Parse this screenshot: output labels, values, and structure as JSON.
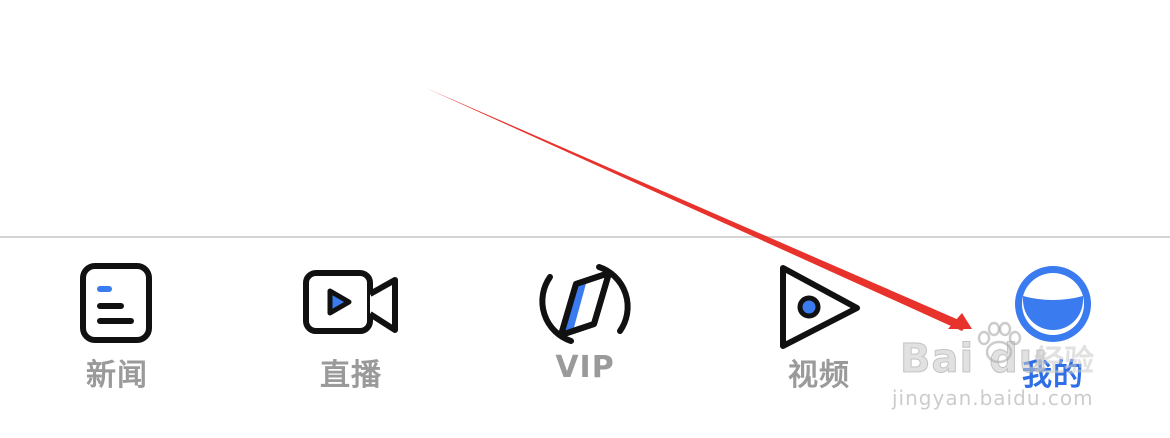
{
  "tab_bar": {
    "items": [
      {
        "label": "新闻",
        "icon": "news-document-icon",
        "active": false
      },
      {
        "label": "直播",
        "icon": "video-camera-icon",
        "active": false
      },
      {
        "label": "VIP",
        "icon": "vip-compass-icon",
        "active": false
      },
      {
        "label": "视频",
        "icon": "play-triangle-icon",
        "active": false
      },
      {
        "label": "我的",
        "icon": "smiley-face-icon",
        "active": true
      }
    ]
  },
  "colors": {
    "active": "#2e6ee6",
    "inactive_label": "#9a9a9a",
    "icon_stroke": "#111111",
    "icon_accent": "#3a7bef",
    "divider": "#d4d4d4",
    "annotation_arrow": "#e8322c"
  },
  "annotation": {
    "type": "arrow",
    "target": "tab-mine",
    "icon": "red-arrow"
  },
  "watermark": {
    "logo_text": "Bai du",
    "cn_text": "经验",
    "url": "jingyan.baidu.com"
  }
}
